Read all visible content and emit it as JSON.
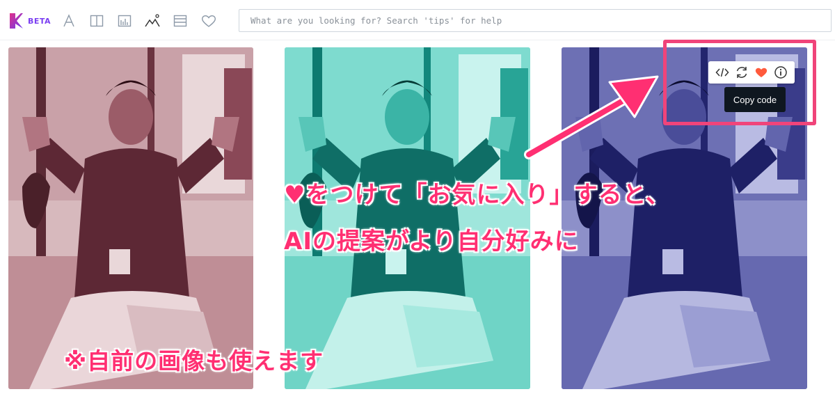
{
  "toolbar": {
    "beta_label": "BETA",
    "icons": [
      "font-icon",
      "columns-icon",
      "chart-icon",
      "image-icon",
      "layout-icon",
      "heart-icon"
    ],
    "brand_color": "#7b3ff2"
  },
  "search": {
    "placeholder": "What are you looking for? Search 'tips' for help",
    "value": ""
  },
  "panels": [
    {
      "tint": "#a04f66",
      "name": "red-duotone"
    },
    {
      "tint": "#2ec7b7",
      "name": "teal-duotone"
    },
    {
      "tint": "#2d2f8f",
      "name": "blue-duotone"
    }
  ],
  "card_tools": {
    "icons": [
      "code-icon",
      "refresh-icon",
      "heart-icon",
      "info-icon"
    ],
    "heart_color": "#ff5a3c"
  },
  "tooltip": {
    "label": "Copy code"
  },
  "annotations": {
    "line1": "♥をつけて「お気に入り」すると、",
    "line2": "AIの提案がより自分好みに",
    "note": "※自前の画像も使えます",
    "color": "#ff2f72",
    "highlight_color": "#f0447a"
  }
}
